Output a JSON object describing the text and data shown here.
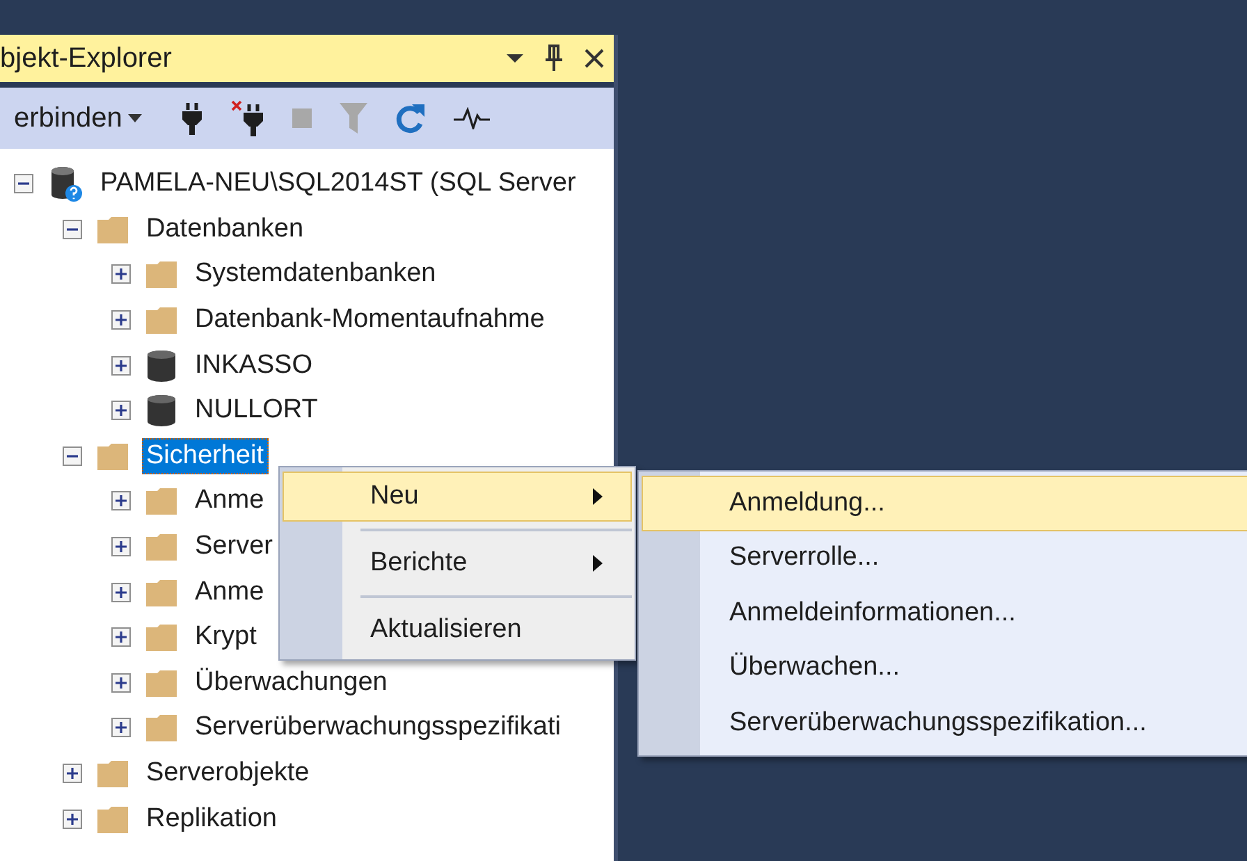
{
  "panel": {
    "title": "bjekt-Explorer",
    "title_buttons": [
      {
        "kind": "dropdown"
      },
      {
        "kind": "pin"
      },
      {
        "kind": "close"
      }
    ]
  },
  "toolbar": {
    "connect_label": "erbinden",
    "buttons": [
      {
        "kind": "connect",
        "disabled": false
      },
      {
        "kind": "disconnect",
        "disabled": false
      },
      {
        "kind": "stop",
        "disabled": true
      },
      {
        "kind": "filter",
        "disabled": true
      },
      {
        "kind": "refresh",
        "disabled": false
      },
      {
        "kind": "activity",
        "disabled": false
      }
    ]
  },
  "tree": [
    {
      "label": "PAMELA-NEU\\SQL2014ST (SQL Server",
      "kind": "server",
      "expanded": true,
      "selected": false,
      "children": [
        {
          "label": "Datenbanken",
          "kind": "folder",
          "expanded": true,
          "selected": false,
          "children": [
            {
              "label": "Systemdatenbanken",
              "kind": "folder",
              "expanded": false,
              "selected": false
            },
            {
              "label": "Datenbank-Momentaufnahme",
              "kind": "folder",
              "expanded": false,
              "selected": false
            },
            {
              "label": "INKASSO",
              "kind": "database",
              "expanded": false,
              "selected": false
            },
            {
              "label": "NULLORT",
              "kind": "database",
              "expanded": false,
              "selected": false
            }
          ]
        },
        {
          "label": "Sicherheit",
          "kind": "folder",
          "expanded": true,
          "selected": true,
          "children": [
            {
              "label": "Anme",
              "kind": "folder",
              "expanded": false,
              "selected": false
            },
            {
              "label": "Server",
              "kind": "folder",
              "expanded": false,
              "selected": false
            },
            {
              "label": "Anme",
              "kind": "folder",
              "expanded": false,
              "selected": false
            },
            {
              "label": "Krypt",
              "kind": "folder",
              "expanded": false,
              "selected": false
            },
            {
              "label": "Überwachungen",
              "kind": "folder",
              "expanded": false,
              "selected": false
            },
            {
              "label": "Serverüberwachungsspezifikati",
              "kind": "folder",
              "expanded": false,
              "selected": false
            }
          ]
        },
        {
          "label": "Serverobjekte",
          "kind": "folder",
          "expanded": false,
          "selected": false
        },
        {
          "label": "Replikation",
          "kind": "folder",
          "expanded": false,
          "selected": false
        }
      ]
    }
  ],
  "context_menu": {
    "items": [
      {
        "label": "Neu",
        "submenu": true,
        "selected": true
      },
      {
        "label": "Berichte",
        "submenu": true,
        "selected": false
      },
      {
        "label": "Aktualisieren",
        "submenu": false,
        "selected": false
      }
    ]
  },
  "submenu": {
    "items": [
      {
        "label": "Anmeldung...",
        "selected": true
      },
      {
        "label": "Serverrolle...",
        "selected": false
      },
      {
        "label": "Anmeldeinformationen...",
        "selected": false
      },
      {
        "label": "Überwachen...",
        "selected": false
      },
      {
        "label": "Serverüberwachungsspezifikation...",
        "selected": false
      }
    ]
  }
}
